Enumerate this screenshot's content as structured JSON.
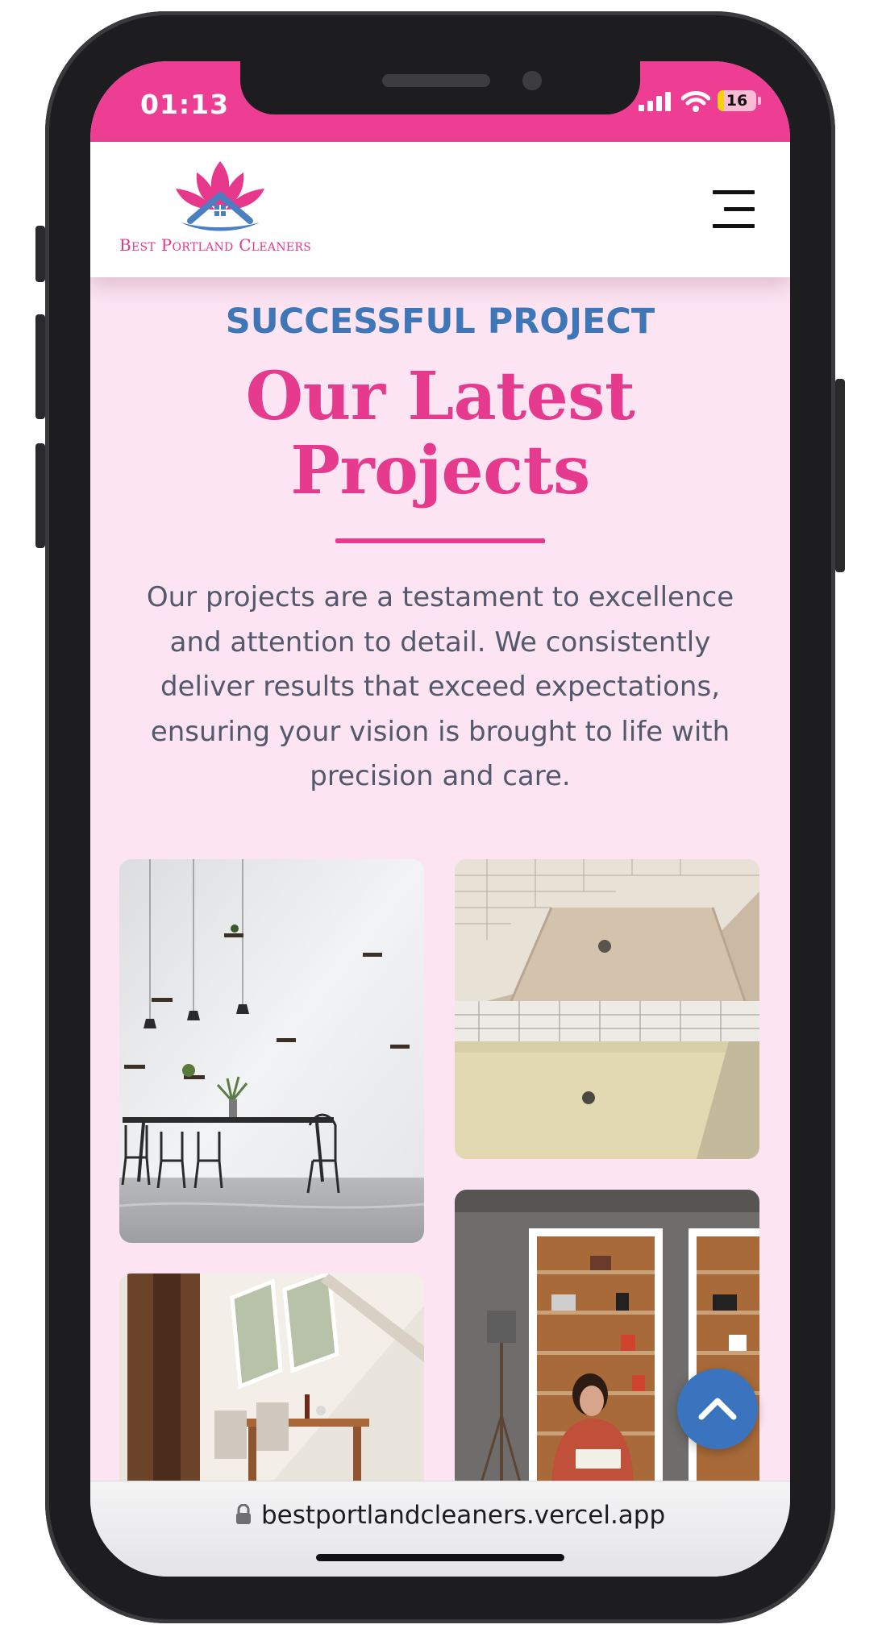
{
  "status_bar": {
    "time": "01:13",
    "battery_level": "16",
    "battery_percent": 16,
    "background_color": "#ed3e93"
  },
  "header": {
    "logo_text": "Best Portland Cleaners",
    "menu_icon": "hamburger-menu-icon"
  },
  "section": {
    "eyebrow": "SUCCESSFUL PROJECT",
    "title_line1": "Our Latest",
    "title_line2": "Projects",
    "description": "Our projects are a testament to excellence and attention to detail. We consistently deliver results that exceed expectations, ensuring your vision is brought to life with precision and care."
  },
  "gallery": {
    "images": [
      "dining room with hanging pendant lights and wall shelves",
      "cleaned bathtub before and after",
      "attic dining room with wooden beams and skylights",
      "woman reading in front of built-in wooden shelves"
    ]
  },
  "scroll_top": {
    "icon": "chevron-up-icon"
  },
  "browser": {
    "url": "bestportlandcleaners.vercel.app"
  },
  "colors": {
    "brand_pink": "#e53a8e",
    "brand_blue": "#3f76b8",
    "page_background": "#fce4f2",
    "body_text": "#52596b"
  }
}
